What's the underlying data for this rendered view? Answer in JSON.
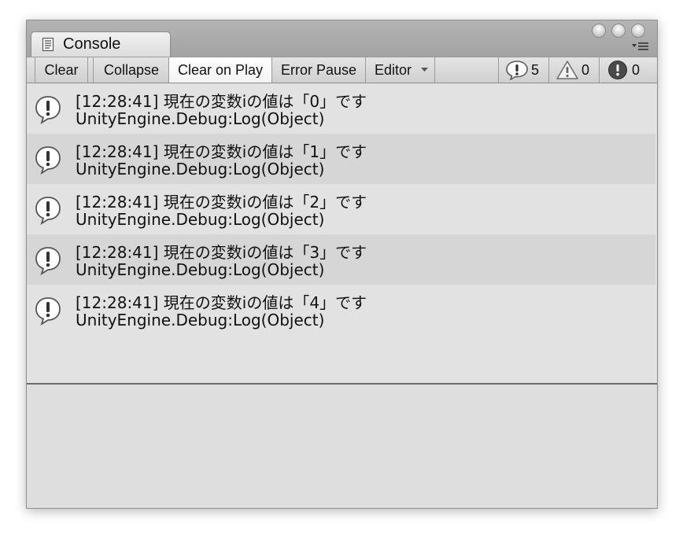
{
  "window": {
    "tab_title": "Console"
  },
  "toolbar": {
    "clear": "Clear",
    "collapse": "Collapse",
    "clear_on_play": "Clear on Play",
    "error_pause": "Error Pause",
    "editor": "Editor",
    "info_count": "5",
    "warning_count": "0",
    "error_count": "0"
  },
  "logs": [
    {
      "message": "[12:28:41] 現在の変数iの値は「0」です",
      "trace": "UnityEngine.Debug:Log(Object)"
    },
    {
      "message": "[12:28:41] 現在の変数iの値は「1」です",
      "trace": "UnityEngine.Debug:Log(Object)"
    },
    {
      "message": "[12:28:41] 現在の変数iの値は「2」です",
      "trace": "UnityEngine.Debug:Log(Object)"
    },
    {
      "message": "[12:28:41] 現在の変数iの値は「3」です",
      "trace": "UnityEngine.Debug:Log(Object)"
    },
    {
      "message": "[12:28:41] 現在の変数iの値は「4」です",
      "trace": "UnityEngine.Debug:Log(Object)"
    }
  ],
  "icons": {
    "tab": "console-document-icon",
    "log": "info-speech-bubble-icon",
    "info": "info-icon",
    "warning": "warning-triangle-icon",
    "error": "error-circle-icon",
    "menu": "window-menu-icon"
  }
}
